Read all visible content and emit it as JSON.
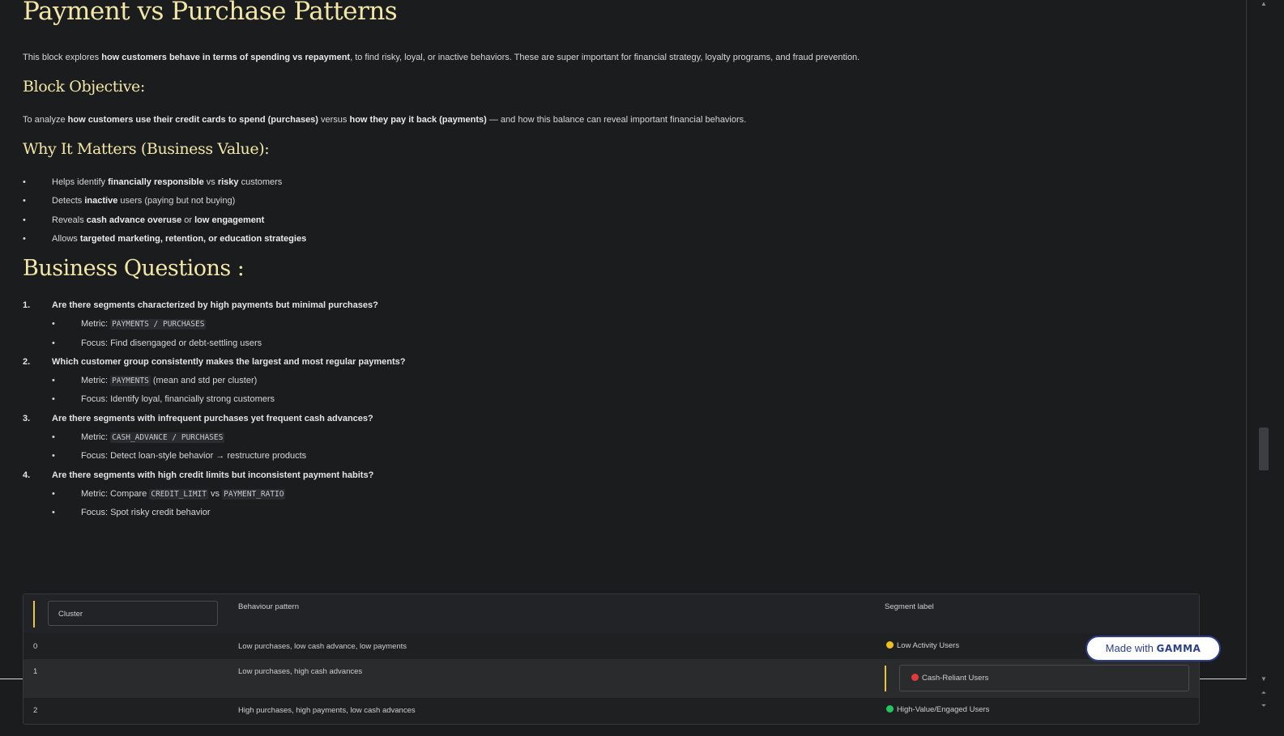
{
  "title": "Payment vs Purchase Patterns",
  "intro": {
    "pre": "This block explores ",
    "bold": "how customers behave in terms of spending vs repayment",
    "post": ", to find risky, loyal, or inactive behaviors. These are super important for financial strategy, loyalty programs, and fraud prevention."
  },
  "objective": {
    "heading": "Block Objective:",
    "pre": "To analyze ",
    "bold1": "how customers use their credit cards to spend (purchases)",
    "mid": " versus ",
    "bold2": "how they pay it back (payments)",
    "post": " — and how this balance can reveal important financial behaviors."
  },
  "why": {
    "heading": "Why It Matters (Business Value):",
    "items": [
      {
        "a": "Helps identify ",
        "b": "financially responsible",
        "c": " vs ",
        "d": "risky",
        "e": " customers"
      },
      {
        "a": "Detects ",
        "b": "inactive",
        "c": " users (paying but not buying)",
        "d": "",
        "e": ""
      },
      {
        "a": "Reveals ",
        "b": "cash advance overuse",
        "c": " or ",
        "d": "low engagement",
        "e": ""
      },
      {
        "a": "Allows ",
        "b": "targeted marketing, retention, or education strategies",
        "c": "",
        "d": "",
        "e": ""
      }
    ]
  },
  "questions": {
    "heading": "Business Questions :",
    "items": [
      {
        "num": "1.",
        "text": "Are there segments characterized by high payments but minimal purchases?",
        "metric_label": "Metric: ",
        "metric_code": "PAYMENTS / PURCHASES",
        "metric_mid": "",
        "metric_code2": "",
        "metric_post": "",
        "focus": "Focus: Find disengaged or debt-settling users"
      },
      {
        "num": "2.",
        "text": "Which customer group consistently makes the largest and most regular payments?",
        "metric_label": "Metric: ",
        "metric_code": "PAYMENTS",
        "metric_mid": " (mean and std per cluster)",
        "metric_code2": "",
        "metric_post": "",
        "focus": "Focus: Identify loyal, financially strong customers"
      },
      {
        "num": "3.",
        "text": "Are there segments with infrequent purchases yet frequent cash advances?",
        "metric_label": "Metric: ",
        "metric_code": "CASH_ADVANCE / PURCHASES",
        "metric_mid": "",
        "metric_code2": "",
        "metric_post": "",
        "focus": "Focus: Detect loan-style behavior → restructure products"
      },
      {
        "num": "4.",
        "text": "Are there segments with high credit limits but inconsistent payment habits?",
        "metric_label": "Metric: Compare ",
        "metric_code": "CREDIT_LIMIT",
        "metric_mid": " vs ",
        "metric_code2": "PAYMENT_RATIO",
        "metric_post": "",
        "focus": "Focus: Spot risky credit behavior"
      }
    ]
  },
  "table": {
    "headers": [
      "Cluster",
      "Behaviour pattern",
      "Segment label"
    ],
    "rows": [
      {
        "cluster": "0",
        "pattern": "Low purchases, low cash advance, low payments",
        "label": "Low Activity Users",
        "color": "#f0c020"
      },
      {
        "cluster": "1",
        "pattern": "Low purchases, high cash advances",
        "label": "Cash-Reliant Users",
        "color": "#e03a3a"
      },
      {
        "cluster": "2",
        "pattern": "High purchases, high payments, low cash advances",
        "label": "High-Value/Engaged Users",
        "color": "#22c55e"
      }
    ]
  },
  "badge": {
    "pre": "Made with ",
    "brand": "GAMMA"
  },
  "bullet_char": "•"
}
